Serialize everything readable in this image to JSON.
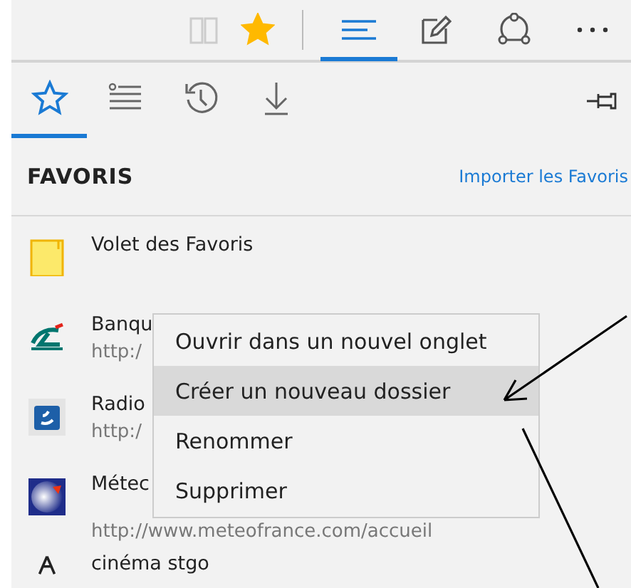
{
  "toolbar": {
    "items": [
      {
        "kind": "reading_view",
        "selected": false
      },
      {
        "kind": "favorite",
        "selected": false,
        "on": true
      },
      {
        "kind": "hub",
        "selected": true
      },
      {
        "kind": "note",
        "selected": false
      },
      {
        "kind": "share",
        "selected": false
      },
      {
        "kind": "more",
        "selected": false
      }
    ]
  },
  "hub_tabs": [
    {
      "kind": "favorites",
      "selected": true
    },
    {
      "kind": "reading_list",
      "selected": false
    },
    {
      "kind": "history",
      "selected": false
    },
    {
      "kind": "downloads",
      "selected": false
    }
  ],
  "panel": {
    "title": "FAVORIS",
    "import_link": "Importer les Favoris"
  },
  "favorites": [
    {
      "kind": "folder",
      "title": "Volet des Favoris"
    },
    {
      "kind": "swoosh",
      "title": "Banqu",
      "url": "http:/"
    },
    {
      "kind": "wave",
      "title": "Radio",
      "url": "http:/"
    },
    {
      "kind": "globe",
      "title": "Métec",
      "url": "http://www.meteofrance.com/accueil"
    },
    {
      "kind": "triangle",
      "title": "cinéma stgo"
    }
  ],
  "context_menu": {
    "items": [
      {
        "label": "Ouvrir dans un nouvel onglet",
        "selected": false
      },
      {
        "label": "Créer un nouveau dossier",
        "selected": true
      },
      {
        "label": "Renommer",
        "selected": false
      },
      {
        "label": "Supprimer",
        "selected": false
      }
    ]
  }
}
